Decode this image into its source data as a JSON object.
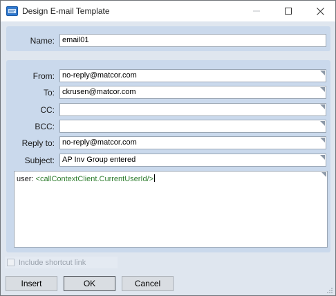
{
  "window": {
    "title": "Design E-mail Template",
    "controls": {
      "minimize": "minimize-icon",
      "maximize": "maximize-icon",
      "close": "close-icon"
    }
  },
  "form": {
    "name": {
      "label": "Name:",
      "value": "email01"
    },
    "from": {
      "label": "From:",
      "value": "no-reply@matcor.com"
    },
    "to": {
      "label": "To:",
      "value": "ckrusen@matcor.com"
    },
    "cc": {
      "label": "CC:",
      "value": ""
    },
    "bcc": {
      "label": "BCC:",
      "value": ""
    },
    "reply_to": {
      "label": "Reply to:",
      "value": "no-reply@matcor.com"
    },
    "subject": {
      "label": "Subject:",
      "value": "AP Inv Group entered"
    },
    "body": {
      "prefix": "user: ",
      "tag": "<callContextClient.CurrentUserId/>"
    }
  },
  "options": {
    "include_shortcut_label": "Include shortcut link",
    "include_shortcut_checked": false
  },
  "buttons": {
    "insert": "Insert",
    "ok": "OK",
    "cancel": "Cancel"
  },
  "colors": {
    "panel": "#cad9ec",
    "tag_text": "#2e7d2e"
  }
}
